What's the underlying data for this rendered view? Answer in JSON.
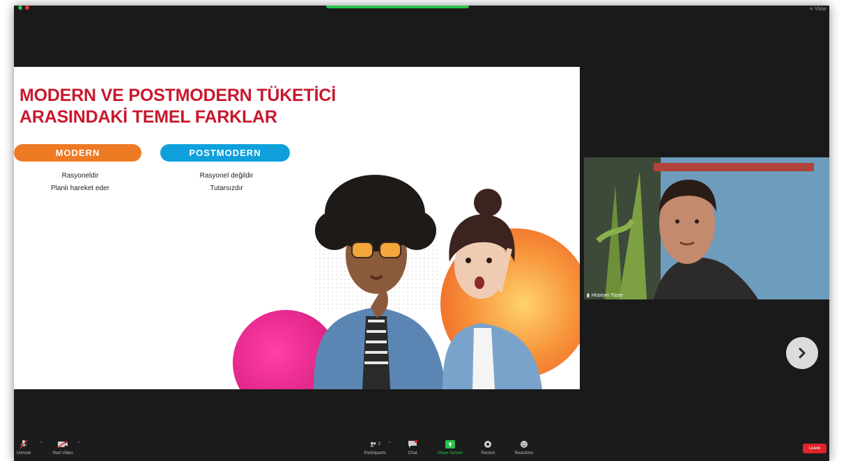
{
  "window": {
    "view_label": "≡ View"
  },
  "slide": {
    "title_line1": "MODERN VE POSTMODERN TÜKETİCİ",
    "title_line2": "ARASINDAKİ TEMEL FARKLAR",
    "modern": {
      "heading": "MODERN",
      "items": [
        "Rasyoneldir",
        "Planlı hareket eder"
      ]
    },
    "postmodern": {
      "heading": "POSTMODERN",
      "items": [
        "Rasyonel değildir",
        "Tutarsızdır"
      ]
    }
  },
  "participant": {
    "name": "Hüseyin Tüzer"
  },
  "toolbar": {
    "items": [
      {
        "label": "Unmute"
      },
      {
        "label": "Start Video"
      },
      {
        "label": "Participants"
      },
      {
        "label": "Chat"
      },
      {
        "label": "Share Screen"
      },
      {
        "label": "Record"
      },
      {
        "label": "Reactions"
      }
    ],
    "participants_count": "2",
    "end_label": "Leave"
  },
  "colors": {
    "title_red": "#c8182d",
    "modern_orange": "#ef7a24",
    "postmodern_blue": "#0fa0dc",
    "share_green": "#27c24c",
    "end_red": "#e0242a"
  }
}
